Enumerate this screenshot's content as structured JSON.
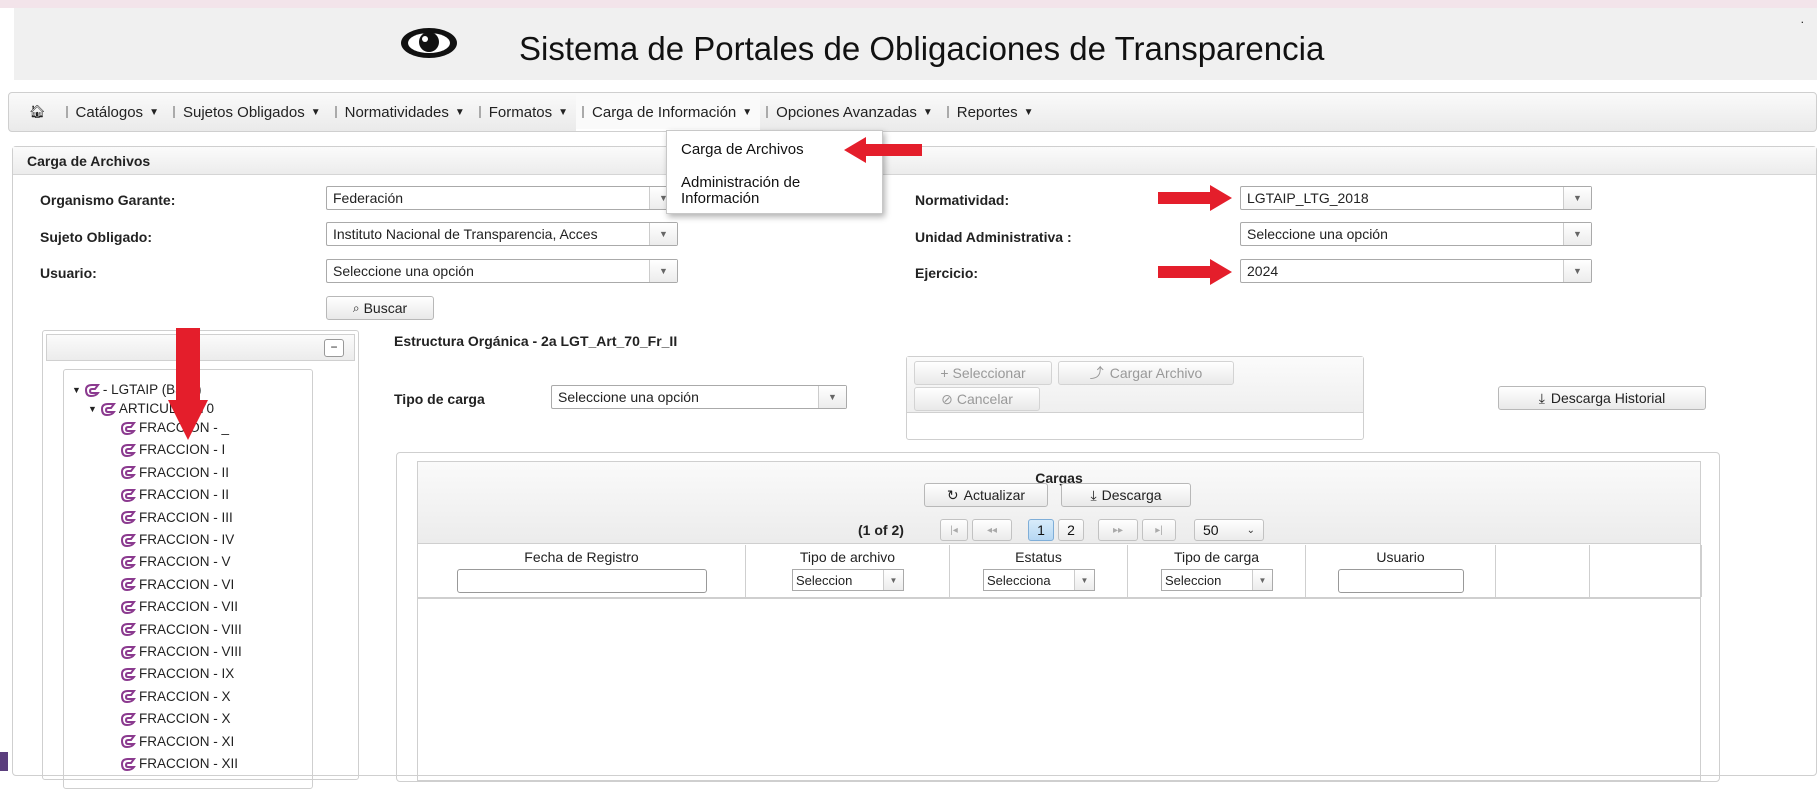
{
  "header": {
    "title": "Sistema de Portales de Obligaciones de Transparencia",
    "corner_mark": "⠂",
    "logo_icon": "eye-icon"
  },
  "menubar": {
    "home_icon": "home-icon",
    "items": [
      {
        "label": "Catálogos"
      },
      {
        "label": "Sujetos Obligados"
      },
      {
        "label": "Normatividades"
      },
      {
        "label": "Formatos"
      },
      {
        "label": "Carga de Información"
      },
      {
        "label": "Opciones Avanzadas"
      },
      {
        "label": "Reportes"
      }
    ]
  },
  "dropdown": {
    "items": [
      {
        "label": "Carga de Archivos"
      },
      {
        "label_line1": "Administración de",
        "label_line2": "Información"
      }
    ]
  },
  "panel": {
    "title": "Carga de Archivos"
  },
  "form": {
    "organismo_label": "Organismo Garante:",
    "organismo_value": "Federación",
    "sujeto_label": "Sujeto Obligado:",
    "sujeto_value": "Instituto Nacional de Transparencia, Acces",
    "usuario_label": "Usuario:",
    "usuario_value": "Seleccione una opción",
    "normatividad_label": "Normatividad:",
    "normatividad_value": "LGTAIP_LTG_2018",
    "unidad_label": "Unidad Administrativa :",
    "unidad_value": "Seleccione una opción",
    "ejercicio_label": "Ejercicio:",
    "ejercicio_value": "2024",
    "buscar_label": "Buscar"
  },
  "tree": {
    "root_label": "- LGTAIP (Base)",
    "article_label": "ARTICULO - 70",
    "fracciones": [
      "FRACCION - _",
      "FRACCION - I",
      "FRACCION - II",
      "FRACCION - II",
      "FRACCION - III",
      "FRACCION - IV",
      "FRACCION - V",
      "FRACCION - VI",
      "FRACCION - VII",
      "FRACCION - VIII",
      "FRACCION - VIII",
      "FRACCION - IX",
      "FRACCION - X",
      "FRACCION - X",
      "FRACCION - XI",
      "FRACCION - XII"
    ]
  },
  "estructura": {
    "title": "Estructura Orgánica - 2a LGT_Art_70_Fr_II",
    "tipo_carga_label": "Tipo de carga",
    "tipo_carga_value": "Seleccione una opción"
  },
  "upload": {
    "seleccionar_label": "Seleccionar",
    "cargar_label": "Cargar Archivo",
    "cancelar_label": "Cancelar"
  },
  "descarga_historial_label": "Descarga Historial",
  "grid": {
    "caption": "Cargas",
    "actualizar_label": "Actualizar",
    "descarga_label": "Descarga",
    "page_info": "(1 of 2)",
    "pages": [
      "1",
      "2"
    ],
    "current_page": 1,
    "rows_per_page": "50",
    "columns": [
      {
        "header": "Fecha de Registro",
        "filter": "input"
      },
      {
        "header": "Tipo de archivo",
        "filter": "select",
        "filter_value": "Seleccion"
      },
      {
        "header": "Estatus",
        "filter": "select",
        "filter_value": "Selecciona"
      },
      {
        "header": "Tipo de carga",
        "filter": "select",
        "filter_value": "Seleccion"
      },
      {
        "header": "Usuario",
        "filter": "input"
      },
      {
        "header": "",
        "filter": "none"
      },
      {
        "header": "",
        "filter": "none"
      }
    ]
  },
  "colors": {
    "annotation_arrow": "#e41e2b",
    "tree_icon": "#8b3a8f",
    "current_page": "#b6d7f3"
  }
}
